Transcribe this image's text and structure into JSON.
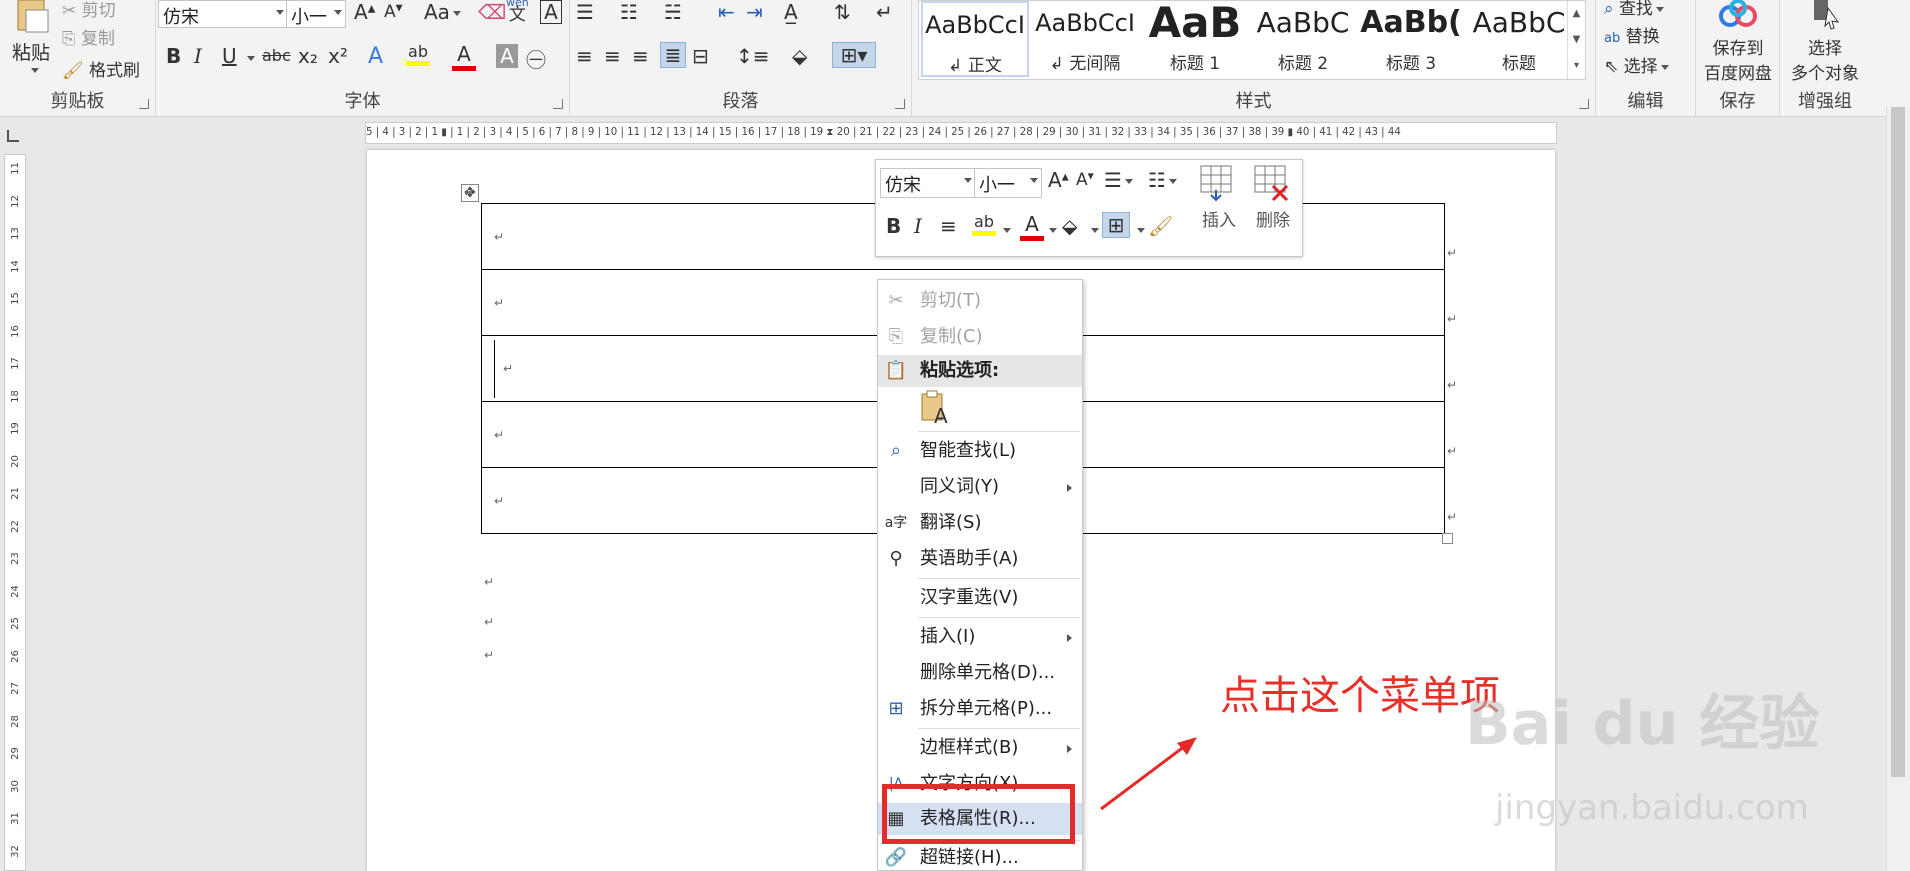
{
  "ribbon": {
    "clipboard": {
      "label": "剪贴板",
      "paste": "粘贴",
      "cut": "剪切",
      "copy": "复制",
      "format_painter": "格式刷"
    },
    "font": {
      "label": "字体",
      "font_name": "仿宋",
      "font_size": "小一",
      "change_case": "Aa",
      "phonetic_top": "wén",
      "phonetic_bottom": "文",
      "char_border": "A",
      "bold": "B",
      "italic": "I",
      "underline": "U",
      "strike": "abc",
      "subscript": "x₂",
      "superscript": "x²",
      "text_effect": "A",
      "highlight": "ab",
      "font_color": "A",
      "char_shading": "A",
      "enclose": "㊀"
    },
    "paragraph": {
      "label": "段落"
    },
    "styles": {
      "label": "样式",
      "items": [
        {
          "preview": "AaBbCcI",
          "name": "↲ 正文"
        },
        {
          "preview": "AaBbCcI",
          "name": "↲ 无间隔"
        },
        {
          "preview": "AaB",
          "name": "标题 1"
        },
        {
          "preview": "AaBbC",
          "name": "标题 2"
        },
        {
          "preview": "AaBb(",
          "name": "标题 3"
        },
        {
          "preview": "AaBbC",
          "name": "标题"
        }
      ]
    },
    "editing": {
      "label": "编辑",
      "find": "查找",
      "replace": "替换",
      "select": "选择"
    },
    "save": {
      "label": "保存",
      "save_to_line1": "保存到",
      "save_to_line2": "百度网盘"
    },
    "enhance": {
      "label": "增强组",
      "select_multi_line1": "选择",
      "select_multi_line2": "多个对象"
    }
  },
  "ruler": {
    "h_ticks": "5 | 4 | 3 | 2 | 1 ▮ | 1 | 2 | 3 | 4 | 5 | 6 | 7 | 8 | 9 | 10 | 11 | 12 | 13 | 14 | 15 | 16 | 17 | 18 | 19 ⧗ 20 | 21 | 22 | 23 | 24 | 25 | 26 | 27 | 28 | 29 | 30 | 31 | 32 | 33 | 34 | 35 | 36 | 37 | 38 | 39 ▮ 40 | 41 | 42 | 43 | 44",
    "v_ticks": [
      "11",
      "12",
      "13",
      "14",
      "15",
      "16",
      "17",
      "18",
      "19",
      "20",
      "21",
      "22",
      "23",
      "24",
      "25",
      "26",
      "27",
      "28",
      "29",
      "30",
      "31",
      "32"
    ]
  },
  "document": {
    "para_mark": "↵",
    "move_handle": "✥"
  },
  "minibar": {
    "font_name": "仿宋",
    "font_size": "小一",
    "insert": "插入",
    "delete": "删除",
    "bold": "B",
    "italic": "I"
  },
  "context_menu": {
    "items": [
      {
        "label": "剪切(T)",
        "icon": "scissors-icon"
      },
      {
        "label": "复制(C)",
        "icon": "copy-icon"
      },
      {
        "label": "粘贴选项:",
        "icon": "paste-icon"
      },
      {
        "label": "智能查找(L)",
        "icon": "search-icon"
      },
      {
        "label": "同义词(Y)",
        "icon": ""
      },
      {
        "label": "翻译(S)",
        "icon": "translate-icon"
      },
      {
        "label": "英语助手(A)",
        "icon": "english-assistant-icon"
      },
      {
        "label": "汉字重选(V)",
        "icon": ""
      },
      {
        "label": "插入(I)",
        "icon": ""
      },
      {
        "label": "删除单元格(D)...",
        "icon": ""
      },
      {
        "label": "拆分单元格(P)...",
        "icon": "split-cells-icon"
      },
      {
        "label": "边框样式(B)",
        "icon": ""
      },
      {
        "label": "文字方向(X)...",
        "icon": "text-direction-icon"
      },
      {
        "label": "表格属性(R)...",
        "icon": "table-properties-icon"
      },
      {
        "label": "超链接(H)...",
        "icon": "hyperlink-icon"
      }
    ],
    "paste_option_glyph": "A"
  },
  "annotation": {
    "text": "点击这个菜单项"
  },
  "watermark": {
    "brand": "Bai du 经验",
    "url": "jingyan.baidu.com"
  },
  "colors": {
    "annotation_red": "#e8302a",
    "menu_highlight": "#d5e1f2",
    "highlight_yellow": "#ffff00",
    "font_red": "#e00000"
  }
}
